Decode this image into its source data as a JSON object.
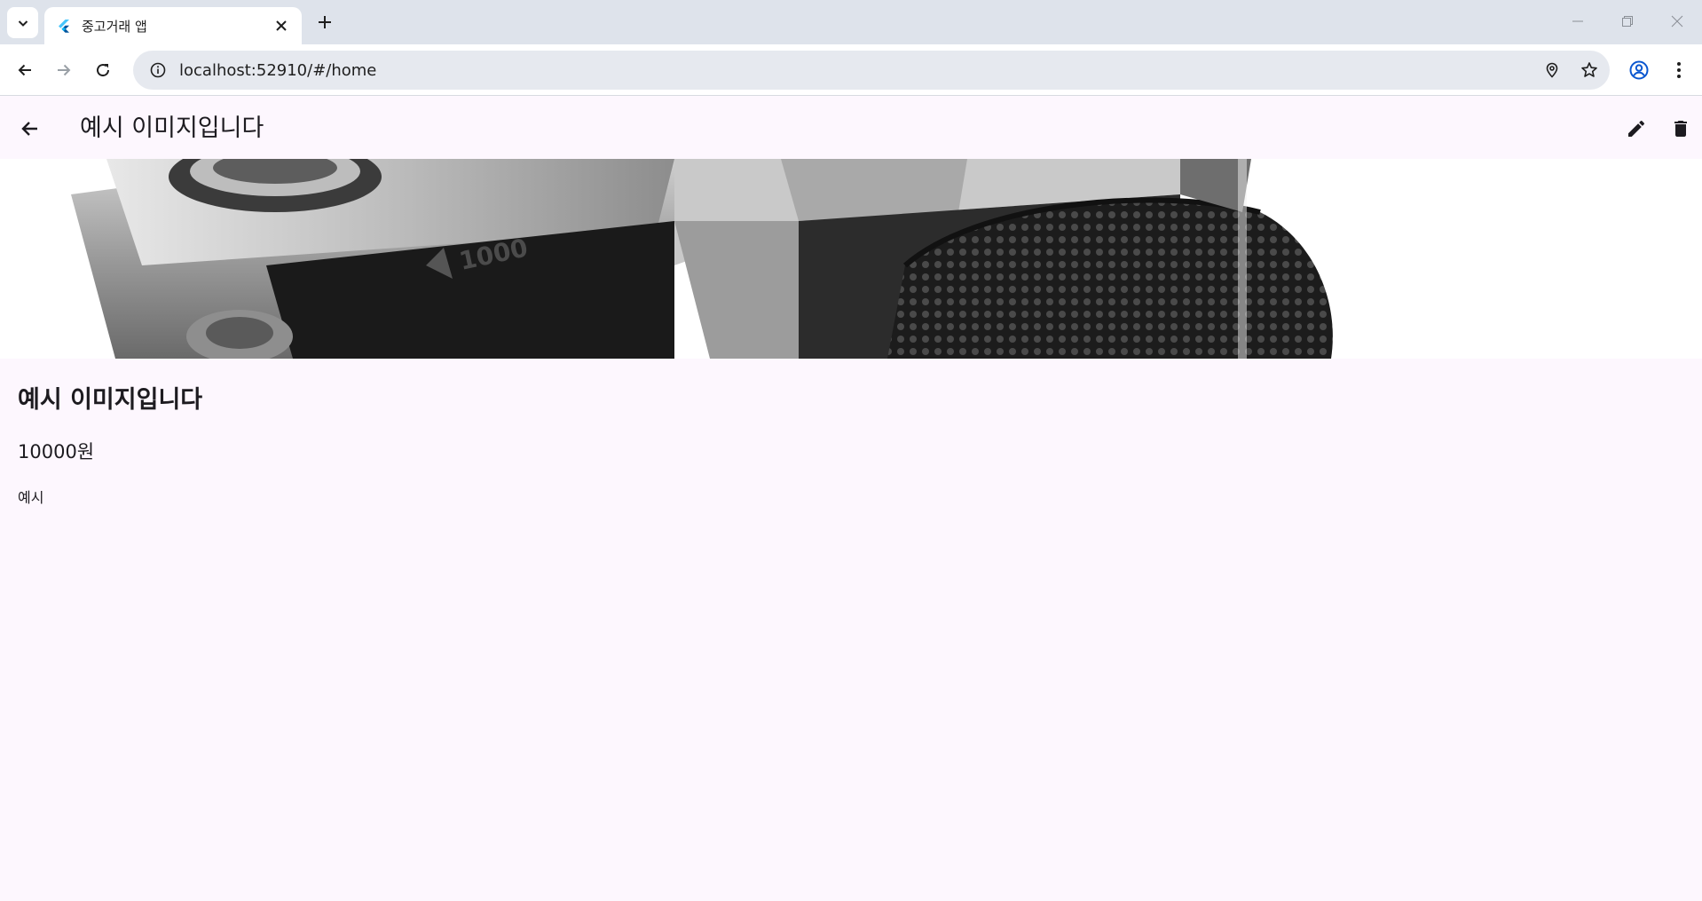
{
  "browser": {
    "tab_title": "중고거래 앱",
    "url": "localhost:52910/#/home"
  },
  "appbar": {
    "title": "예시 이미지입니다"
  },
  "product": {
    "image_alt": "camera photo",
    "title": "예시 이미지입니다",
    "price": "10000원",
    "description": "예시"
  },
  "colors": {
    "page_background": "#fdf7fe",
    "tabstrip": "#dee3eb",
    "omnibox": "#e6e9ef",
    "text": "#1d1b20"
  }
}
